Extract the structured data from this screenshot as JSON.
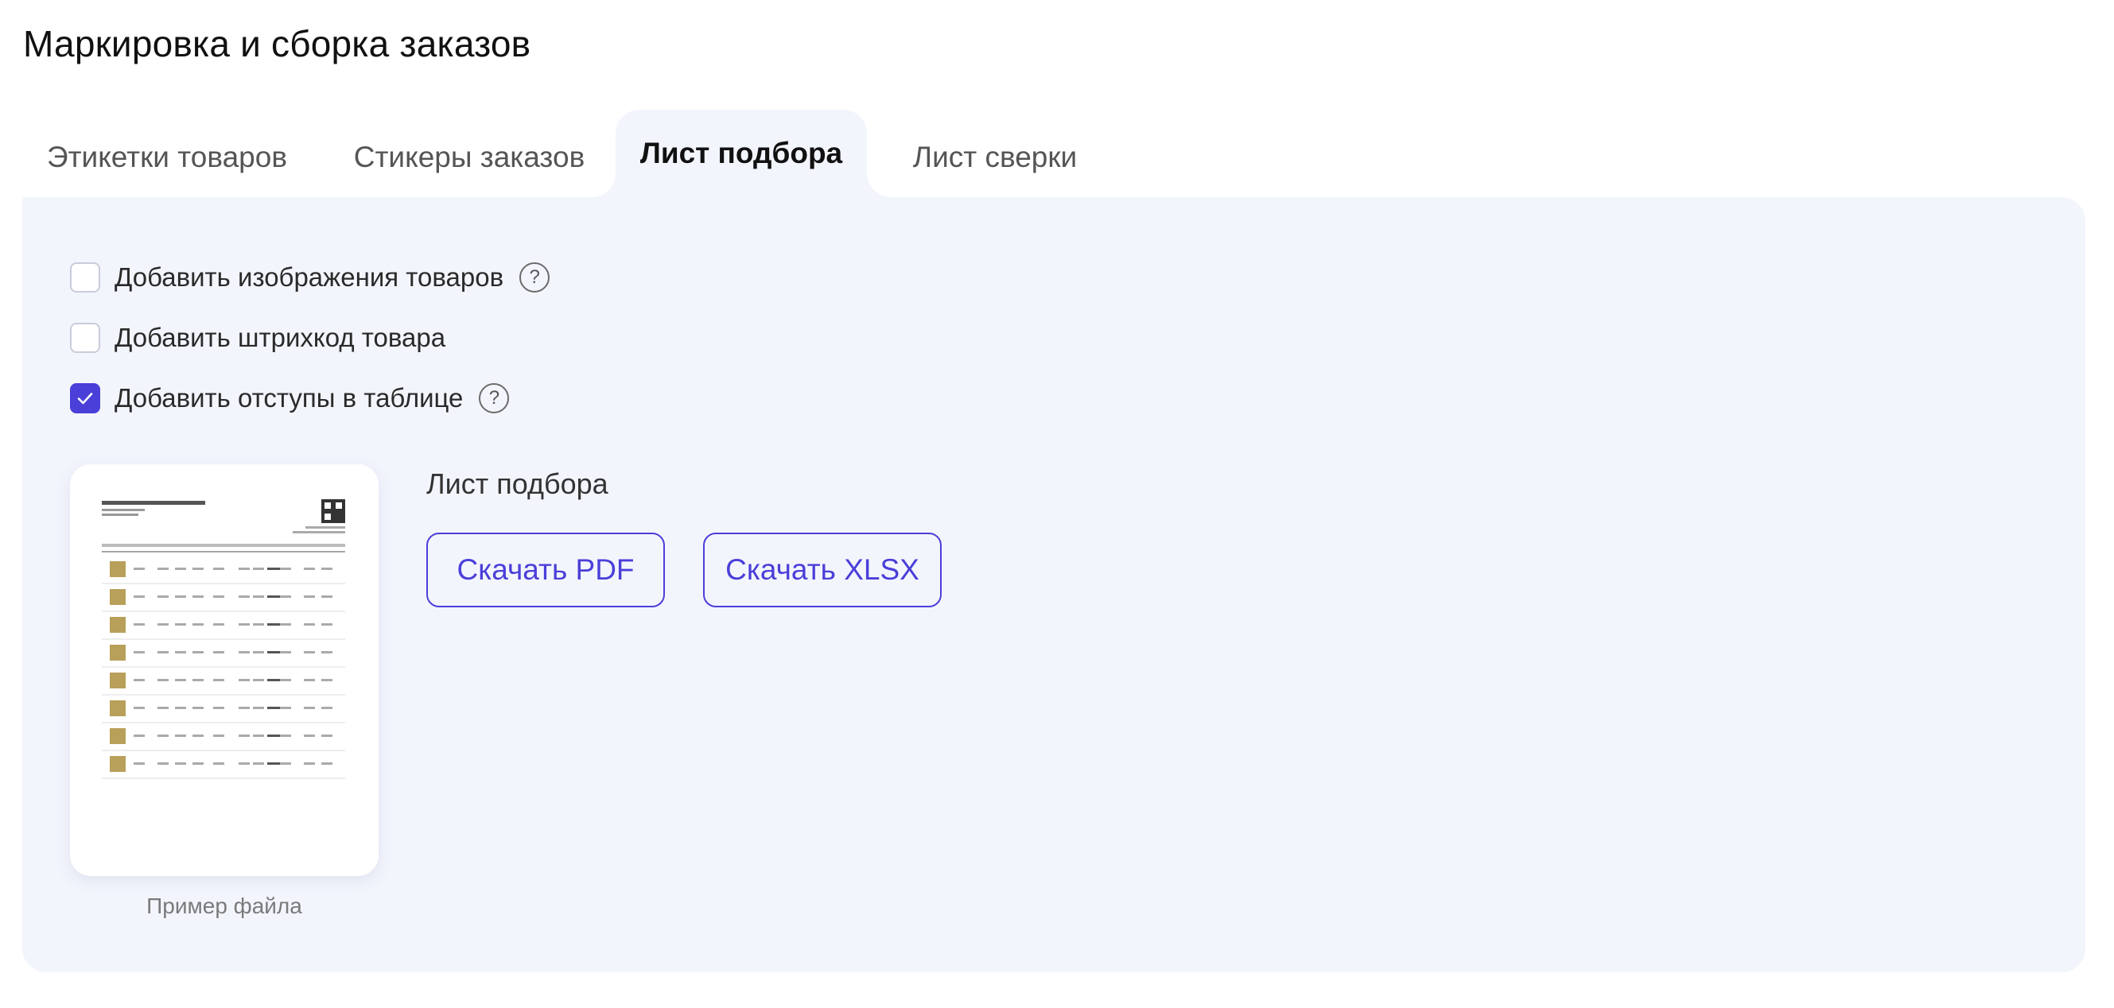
{
  "page": {
    "title": "Маркировка и сборка заказов"
  },
  "tabs": [
    {
      "label": "Этикетки товаров",
      "active": false
    },
    {
      "label": "Стикеры заказов",
      "active": false
    },
    {
      "label": "Лист подбора",
      "active": true
    },
    {
      "label": "Лист сверки",
      "active": false
    }
  ],
  "options": [
    {
      "label": "Добавить изображения товаров",
      "checked": false,
      "help": true
    },
    {
      "label": "Добавить штрихкод товара",
      "checked": false,
      "help": false
    },
    {
      "label": "Добавить отступы в таблице",
      "checked": true,
      "help": true
    }
  ],
  "help_glyph": "?",
  "preview": {
    "caption": "Пример файла"
  },
  "section": {
    "title": "Лист подбора"
  },
  "buttons": {
    "pdf": "Скачать PDF",
    "xlsx": "Скачать XLSX"
  },
  "colors": {
    "accent": "#4a3fd8",
    "panel_bg": "#f3f5fd",
    "text": "#1f1f1f"
  },
  "icons": {
    "check": "checkmark-icon",
    "help": "question-circle-icon"
  }
}
